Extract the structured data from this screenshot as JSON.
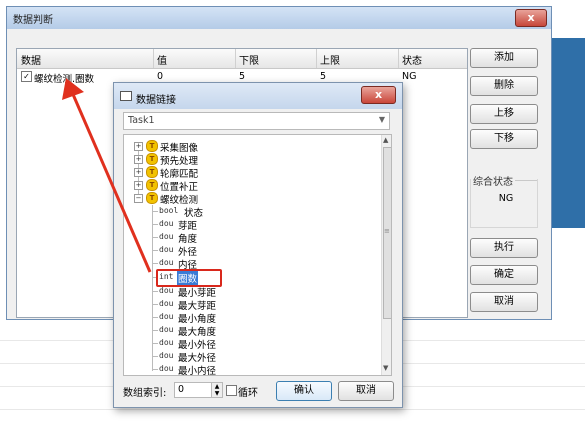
{
  "window": {
    "title": "数据判断",
    "close": "x",
    "columns": [
      "数据",
      "值",
      "下限",
      "上限",
      "状态"
    ],
    "row": {
      "checked": "✓",
      "data": "螺纹检测.圈数",
      "value": "0",
      "lower": "5",
      "upper": "5",
      "status": "NG"
    },
    "buttons": {
      "add": "添加",
      "delete": "删除",
      "up": "上移",
      "down": "下移",
      "run": "执行",
      "ok": "确定",
      "cancel": "取消"
    },
    "summary": {
      "label": "综合状态",
      "value": "NG"
    }
  },
  "dialog": {
    "title": "数据链接",
    "close": "x",
    "task": "Task1",
    "tree": {
      "groups": [
        "采集图像",
        "预先处理",
        "轮廓匹配",
        "位置补正",
        "螺纹检测"
      ],
      "children": [
        {
          "type": "bool",
          "label": "状态"
        },
        {
          "type": "dou",
          "label": "芽距"
        },
        {
          "type": "dou",
          "label": "角度"
        },
        {
          "type": "dou",
          "label": "外径"
        },
        {
          "type": "dou",
          "label": "内径"
        },
        {
          "type": "int",
          "label": "圈数"
        },
        {
          "type": "dou",
          "label": "最小芽距"
        },
        {
          "type": "dou",
          "label": "最大芽距"
        },
        {
          "type": "dou",
          "label": "最小角度"
        },
        {
          "type": "dou",
          "label": "最大角度"
        },
        {
          "type": "dou",
          "label": "最小外径"
        },
        {
          "type": "dou",
          "label": "最大外径"
        },
        {
          "type": "dou",
          "label": "最小内径"
        }
      ]
    },
    "bottom": {
      "index_label": "数组索引:",
      "index_value": "0",
      "loop_label": "循环",
      "confirm": "确认",
      "cancel": "取消"
    }
  },
  "colors": {
    "accent": "#3a7bd5",
    "highlight_box": "#d9281c",
    "arrow": "#e0301e"
  }
}
